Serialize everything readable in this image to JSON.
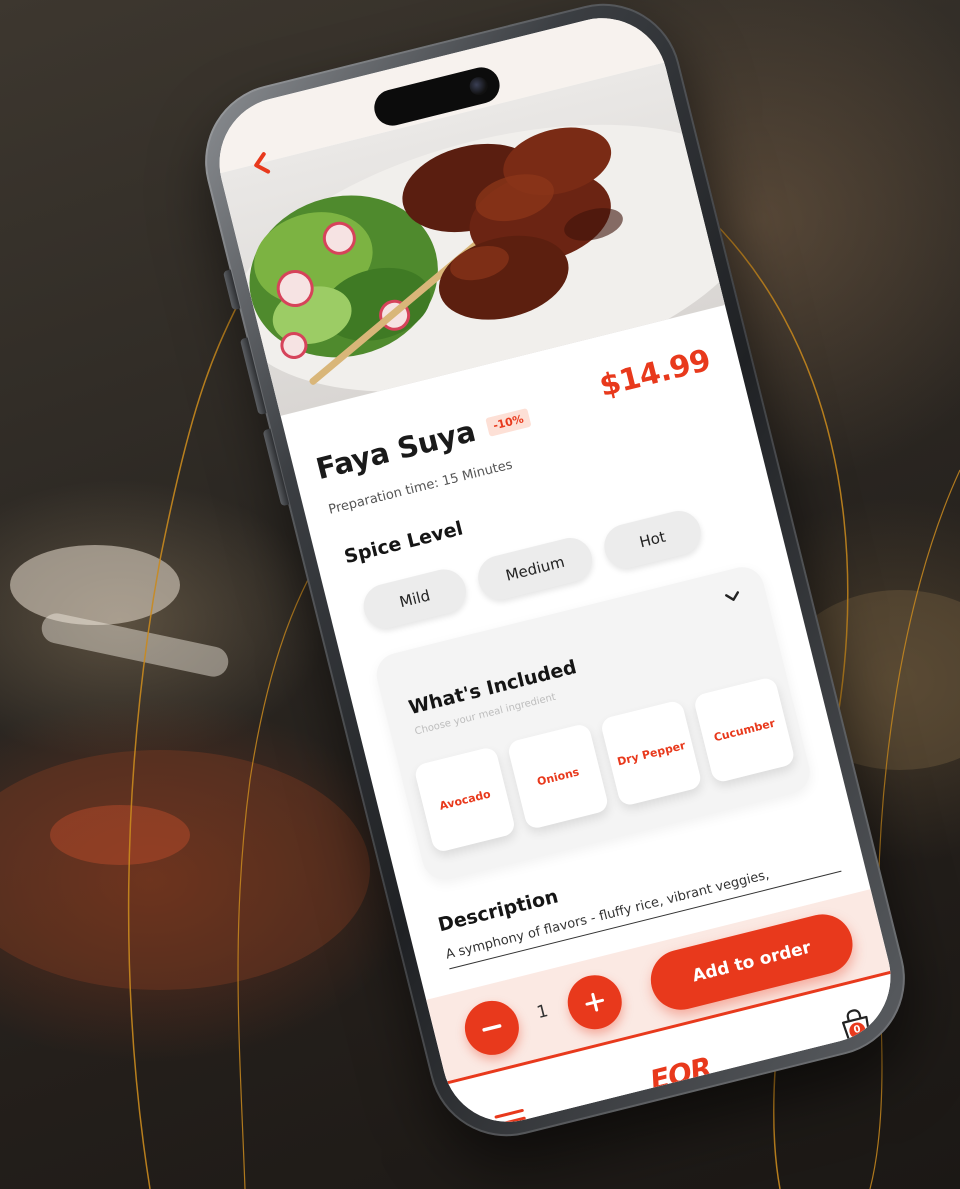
{
  "colors": {
    "accent": "#e8391c",
    "badge_bg": "#fde0d6",
    "order_bar_bg": "#fbe9e3",
    "chip_bg": "#ececec",
    "card_bg": "#f4f4f4",
    "gold_line": "#c98a1e"
  },
  "icons": {
    "back": "chevron-left-icon",
    "expand": "chevron-down-icon",
    "minus": "minus-icon",
    "plus": "plus-icon",
    "menu": "menu-icon",
    "cart": "shopping-bag-icon"
  },
  "dish": {
    "name": "Faya Suya",
    "discount": "-10%",
    "price": "$14.99",
    "prep_time": "Preparation time: 15 Minutes"
  },
  "spice": {
    "title": "Spice Level",
    "options": [
      "Mild",
      "Medium",
      "Hot"
    ]
  },
  "included": {
    "title": "What's Included",
    "subtitle": "Choose your meal ingredient",
    "items": [
      "Avocado",
      "Onions",
      "Dry Pepper",
      "Cucumber"
    ]
  },
  "description": {
    "title": "Description",
    "text": "A symphony of flavors - fluffy rice, vibrant veggies,"
  },
  "order": {
    "quantity": "1",
    "add_label": "Add to order"
  },
  "nav": {
    "logo": "EQR",
    "cart_count": "0"
  }
}
